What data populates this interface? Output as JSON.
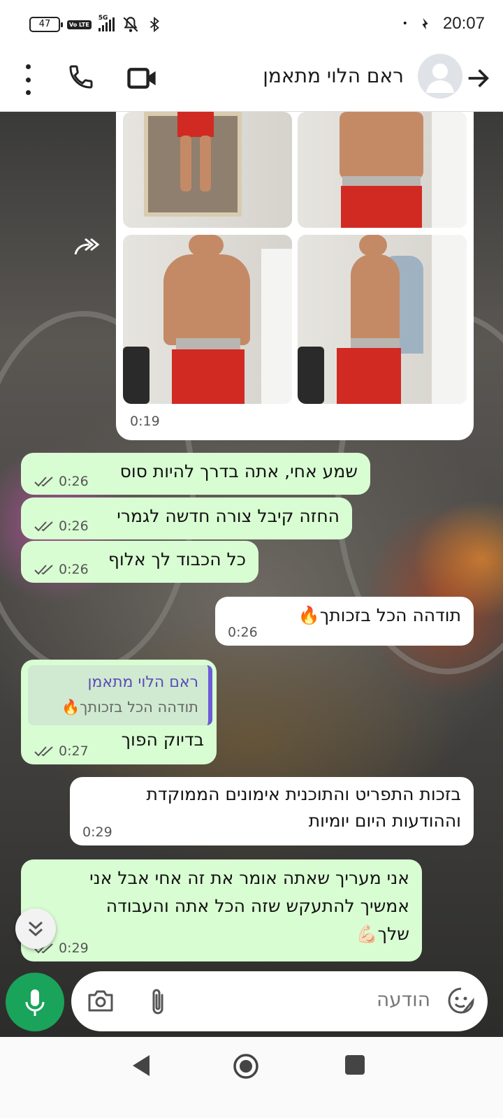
{
  "status_bar": {
    "battery": "47",
    "volte": "Vo LTE",
    "network": "5G",
    "time": "20:07"
  },
  "header": {
    "contact_name": "ראם הלוי מתאמן"
  },
  "image_message": {
    "time": "0:19"
  },
  "messages": [
    {
      "text": "שמע אחי, אתה בדרך להיות סוס",
      "time": "0:26"
    },
    {
      "text": "החזה קיבל צורה חדשה לגמרי",
      "time": "0:26"
    },
    {
      "text": "כל הכבוד לך אלוף",
      "time": "0:26"
    },
    {
      "text": "תודהה הכל בזכותך🔥",
      "time": "0:26"
    },
    {
      "quote_name": "ראם הלוי מתאמן",
      "quote_text": "תודהה הכל בזכותך🔥",
      "text": "בדיוק הפוך",
      "time": "0:27"
    },
    {
      "line1": "בזכות התפריט והתוכנית אימונים הממוקדת",
      "line2": "וההודעות היום יומיות",
      "time": "0:29"
    },
    {
      "line1": "אני מעריך שאתה אומר את זה אחי אבל אני",
      "line2": "אמשיך להתעקש שזה הכל אתה והעבודה",
      "line3": "שלך💪🏻",
      "time": "0:29"
    }
  ],
  "input": {
    "placeholder": "הודעה"
  },
  "colors": {
    "sent_bubble": "#d9fdd3",
    "received_bubble": "#ffffff",
    "mic_button": "#1aa35a",
    "quote_bar": "#6b5bd6"
  }
}
